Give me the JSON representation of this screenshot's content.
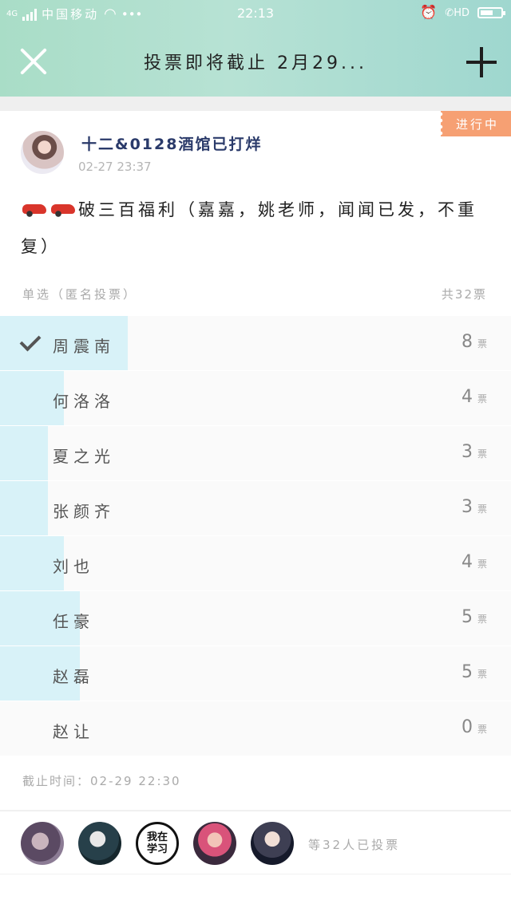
{
  "status_bar": {
    "network": "4G",
    "carrier": "中国移动",
    "more": "•••",
    "time": "22:13",
    "hd": "HD"
  },
  "header": {
    "title": "投票即将截止 2月29..."
  },
  "poll": {
    "status_badge": "进行中",
    "author": "十二&0128酒馆已打烊",
    "post_time": "02-27 23:37",
    "text": "破三百福利（嘉嘉，姚老师，闻闻已发，不重复）",
    "vote_type": "单选（匿名投票）",
    "total": "共32票",
    "total_votes": 32,
    "options": [
      {
        "label": "周震南",
        "votes": "8",
        "unit": "票",
        "share": 0.25,
        "selected": true
      },
      {
        "label": "何洛洛",
        "votes": "4",
        "unit": "票",
        "share": 0.125,
        "selected": false
      },
      {
        "label": "夏之光",
        "votes": "3",
        "unit": "票",
        "share": 0.094,
        "selected": false
      },
      {
        "label": "张颜齐",
        "votes": "3",
        "unit": "票",
        "share": 0.094,
        "selected": false
      },
      {
        "label": "刘也",
        "votes": "4",
        "unit": "票",
        "share": 0.125,
        "selected": false
      },
      {
        "label": "任豪",
        "votes": "5",
        "unit": "票",
        "share": 0.156,
        "selected": false
      },
      {
        "label": "赵磊",
        "votes": "5",
        "unit": "票",
        "share": 0.156,
        "selected": false
      },
      {
        "label": "赵让",
        "votes": "0",
        "unit": "票",
        "share": 0.0,
        "selected": false
      }
    ],
    "deadline": "截止时间：02-29 22:30",
    "voter_avatar_3_text": "我在学习",
    "voters_summary": "等32人已投票"
  },
  "colors": {
    "header_gradient": "#a9ddc7",
    "badge": "#f6a073",
    "bar": "#d8f2f8"
  }
}
